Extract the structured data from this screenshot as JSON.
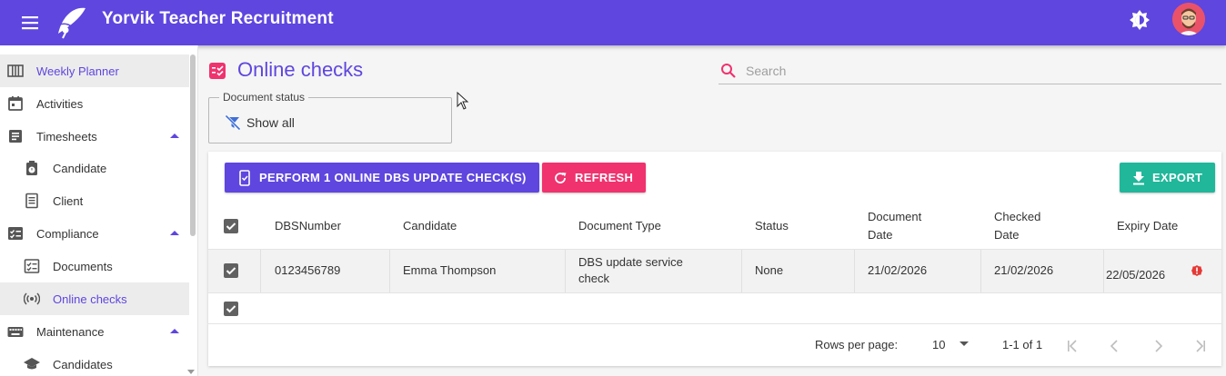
{
  "app": {
    "title": "Yorvik Teacher Recruitment",
    "accent_color": "#5e46df",
    "icons": {
      "menu": "hamburger-menu-icon",
      "logo": "app-logo-icon",
      "theme": "brightness-icon",
      "avatar": "user-avatar"
    }
  },
  "sidebar": {
    "items": [
      {
        "label": "Weekly Planner",
        "icon": "view-week-icon",
        "active": true
      },
      {
        "label": "Activities",
        "icon": "calendar-icon"
      },
      {
        "label": "Timesheets",
        "icon": "timesheet-icon",
        "expanded": true
      },
      {
        "label": "Candidate",
        "icon": "stopwatch-icon",
        "sub": true
      },
      {
        "label": "Client",
        "icon": "receipt-icon",
        "sub": true
      },
      {
        "label": "Compliance",
        "icon": "checklist-icon",
        "expanded": true
      },
      {
        "label": "Documents",
        "icon": "document-check-icon",
        "sub": true
      },
      {
        "label": "Online checks",
        "icon": "broadcast-icon",
        "sub": true,
        "active": true
      },
      {
        "label": "Maintenance",
        "icon": "keyboard-icon",
        "expanded": true
      },
      {
        "label": "Candidates",
        "icon": "school-icon",
        "sub": true
      }
    ]
  },
  "page": {
    "title": "Online checks",
    "search_placeholder": "Search"
  },
  "filter": {
    "legend": "Document status",
    "value": "Show all"
  },
  "toolbar": {
    "dbs_label": "PERFORM 1 ONLINE DBS UPDATE CHECK(S)",
    "refresh_label": "REFRESH",
    "export_label": "EXPORT",
    "colors": {
      "dbs": "#5e46df",
      "refresh": "#f0326f",
      "export": "#20b79a"
    }
  },
  "table": {
    "columns": [
      {
        "label": "DBSNumber"
      },
      {
        "label": "Candidate"
      },
      {
        "label": "Document Type"
      },
      {
        "label": "Status"
      },
      {
        "label": "Document Date",
        "line1": "Document",
        "line2": "Date"
      },
      {
        "label": "Checked Date",
        "line1": "Checked",
        "line2": "Date"
      },
      {
        "label": "Expiry Date"
      }
    ],
    "rows": [
      {
        "checked": true,
        "dbs_number": "0123456789",
        "candidate": "Emma Thompson",
        "document_type_line1": "DBS update service",
        "document_type_line2": "check",
        "status": "None",
        "document_date": "21/02/2026",
        "checked_date": "21/02/2026",
        "expiry_date": "22/05/2026",
        "expiry_warning_icon": "error-badge-icon"
      }
    ]
  },
  "pagination": {
    "rows_per_page_label": "Rows per page:",
    "rows_per_page_value": "10",
    "range": "1-1 of 1"
  }
}
